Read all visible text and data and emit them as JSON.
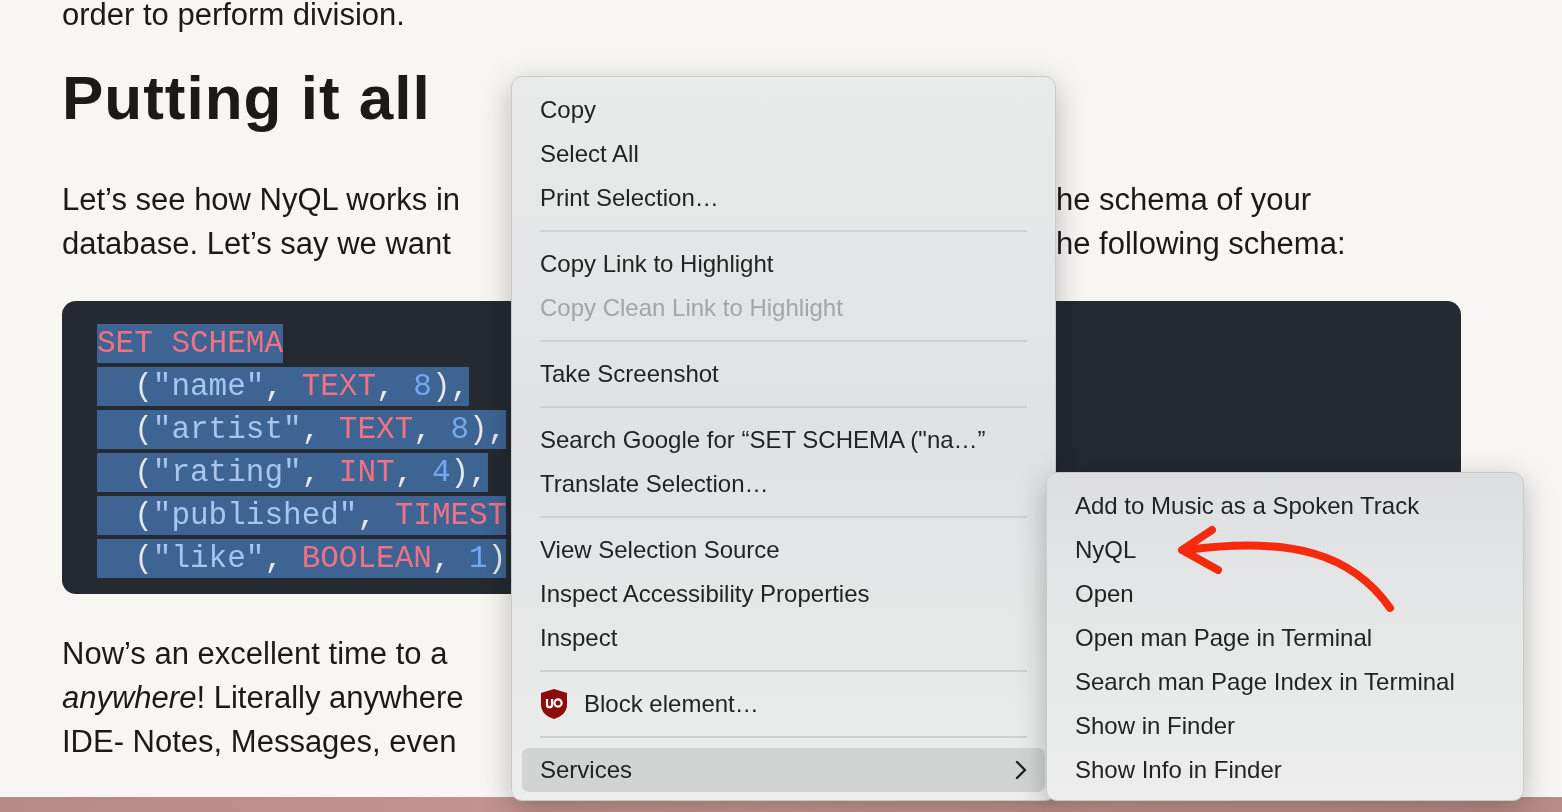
{
  "article": {
    "lead_line": "order to perform division.",
    "heading": "Putting it all",
    "intro_lines": [
      {
        "left": "Let’s see how NyQL works in",
        "right": "he schema of your"
      },
      {
        "left": "database. Let’s say we want",
        "right": "he following schema:"
      }
    ],
    "code_lines": [
      [
        {
          "text": "SET SCHEMA",
          "kind": "keyword"
        }
      ],
      [
        {
          "text": "  (",
          "kind": "punct"
        },
        {
          "text": "\"name\"",
          "kind": "string"
        },
        {
          "text": ", ",
          "kind": "punct"
        },
        {
          "text": "TEXT",
          "kind": "keyword"
        },
        {
          "text": ", ",
          "kind": "punct"
        },
        {
          "text": "8",
          "kind": "number"
        },
        {
          "text": "),",
          "kind": "punct"
        }
      ],
      [
        {
          "text": "  (",
          "kind": "punct"
        },
        {
          "text": "\"artist\"",
          "kind": "string"
        },
        {
          "text": ", ",
          "kind": "punct"
        },
        {
          "text": "TEXT",
          "kind": "keyword"
        },
        {
          "text": ", ",
          "kind": "punct"
        },
        {
          "text": "8",
          "kind": "number"
        },
        {
          "text": "),",
          "kind": "punct"
        }
      ],
      [
        {
          "text": "  (",
          "kind": "punct"
        },
        {
          "text": "\"rating\"",
          "kind": "string"
        },
        {
          "text": ", ",
          "kind": "punct"
        },
        {
          "text": "INT",
          "kind": "keyword"
        },
        {
          "text": ", ",
          "kind": "punct"
        },
        {
          "text": "4",
          "kind": "number"
        },
        {
          "text": "),",
          "kind": "punct"
        }
      ],
      [
        {
          "text": "  (",
          "kind": "punct"
        },
        {
          "text": "\"published\"",
          "kind": "string"
        },
        {
          "text": ", ",
          "kind": "punct"
        },
        {
          "text": "TIMEST",
          "kind": "keyword"
        }
      ],
      [
        {
          "text": "  (",
          "kind": "punct"
        },
        {
          "text": "\"like\"",
          "kind": "string"
        },
        {
          "text": ", ",
          "kind": "punct"
        },
        {
          "text": "BOOLEAN",
          "kind": "keyword"
        },
        {
          "text": ", ",
          "kind": "punct"
        },
        {
          "text": "1",
          "kind": "number"
        },
        {
          "text": ")",
          "kind": "punct"
        }
      ]
    ],
    "outro_lines": [
      "Now’s an excellent time to a",
      "*anywhere*! Literally anywhere",
      "IDE- Notes, Messages, even"
    ]
  },
  "context_menu": {
    "items": [
      {
        "kind": "item",
        "label": "Copy",
        "disabled": false,
        "selected": false
      },
      {
        "kind": "item",
        "label": "Select All",
        "disabled": false,
        "selected": false
      },
      {
        "kind": "item",
        "label": "Print Selection…",
        "disabled": false,
        "selected": false
      },
      {
        "kind": "separator"
      },
      {
        "kind": "item",
        "label": "Copy Link to Highlight",
        "disabled": false,
        "selected": false
      },
      {
        "kind": "item",
        "label": "Copy Clean Link to Highlight",
        "disabled": true,
        "selected": false
      },
      {
        "kind": "separator"
      },
      {
        "kind": "item",
        "label": "Take Screenshot",
        "disabled": false,
        "selected": false
      },
      {
        "kind": "separator"
      },
      {
        "kind": "item",
        "label": "Search Google for “SET SCHEMA (\"na…”",
        "disabled": false,
        "selected": false
      },
      {
        "kind": "item",
        "label": "Translate Selection…",
        "disabled": false,
        "selected": false
      },
      {
        "kind": "separator"
      },
      {
        "kind": "item",
        "label": "View Selection Source",
        "disabled": false,
        "selected": false
      },
      {
        "kind": "item",
        "label": "Inspect Accessibility Properties",
        "disabled": false,
        "selected": false
      },
      {
        "kind": "item",
        "label": "Inspect",
        "disabled": false,
        "selected": false
      },
      {
        "kind": "separator"
      },
      {
        "kind": "icon_item",
        "label": "Block element…",
        "disabled": false,
        "selected": false
      },
      {
        "kind": "separator"
      },
      {
        "kind": "submenu",
        "label": "Services",
        "disabled": false,
        "selected": true
      }
    ]
  },
  "services_submenu": {
    "items": [
      {
        "label": "Add to Music as a Spoken Track",
        "selected": false
      },
      {
        "label": "NyQL",
        "selected": false
      },
      {
        "label": "Open",
        "selected": false
      },
      {
        "label": "Open man Page in Terminal",
        "selected": false
      },
      {
        "label": "Search man Page Index in Terminal",
        "selected": false
      },
      {
        "label": "Show in Finder",
        "selected": false
      },
      {
        "label": "Show Info in Finder",
        "selected": false
      }
    ]
  }
}
